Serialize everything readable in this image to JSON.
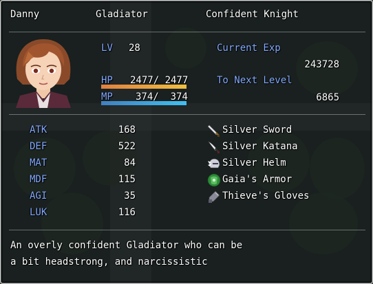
{
  "actor": {
    "name": "Danny",
    "class": "Gladiator",
    "nickname": "Confident Knight"
  },
  "status": {
    "level_label": "LV",
    "level": "28",
    "hp_label": "HP",
    "hp_current": "2477",
    "hp_max": "2477",
    "hp_fraction": 1.0,
    "mp_label": "MP",
    "mp_current": "374",
    "mp_max": "374",
    "mp_fraction": 1.0,
    "exp_current_label": "Current Exp",
    "exp_current": "243728",
    "exp_next_label": "To Next Level",
    "exp_next": "6865"
  },
  "params": [
    {
      "label": "ATK",
      "value": "168"
    },
    {
      "label": "DEF",
      "value": "522"
    },
    {
      "label": "MAT",
      "value": "84"
    },
    {
      "label": "MDF",
      "value": "115"
    },
    {
      "label": "AGI",
      "value": "35"
    },
    {
      "label": "LUK",
      "value": "116"
    }
  ],
  "equipment": [
    {
      "name": "Silver Sword",
      "icon": "sword-icon"
    },
    {
      "name": "Silver Katana",
      "icon": "katana-icon"
    },
    {
      "name": "Silver Helm",
      "icon": "helm-icon"
    },
    {
      "name": "Gaia's Armor",
      "icon": "armor-icon"
    },
    {
      "name": "Thieve's Gloves",
      "icon": "gloves-icon"
    }
  ],
  "profile": {
    "line1": "An overly confident Gladiator who can be",
    "line2": "a bit headstrong, and narcissistic"
  },
  "colors": {
    "system": "#84aaff",
    "hp_gauge_start": "#e08040",
    "hp_gauge_end": "#f0c040",
    "mp_gauge_start": "#4080c0",
    "mp_gauge_end": "#40c0f0"
  }
}
